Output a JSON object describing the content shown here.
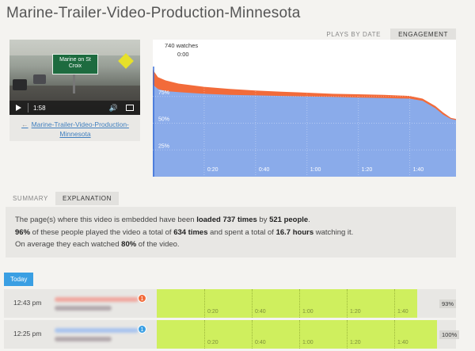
{
  "page_title": "Marine-Trailer-Video-Production-Minnesota",
  "top_tabs": [
    {
      "label": "PLAYS BY DATE",
      "active": false
    },
    {
      "label": "ENGAGEMENT",
      "active": true
    }
  ],
  "video": {
    "sign_text": "Marine on St Croix",
    "time": "1:58",
    "link": "Marine-Trailer-Video-Production-Minnesota"
  },
  "chart_data": {
    "type": "area",
    "x_unit": "seconds",
    "xlim": [
      0,
      118
    ],
    "ylim": [
      0,
      100
    ],
    "x_ticks": [
      20,
      40,
      60,
      80,
      100
    ],
    "x_tick_labels": [
      "0:20",
      "0:40",
      "1:00",
      "1:20",
      "1:40"
    ],
    "y_ticks": [
      25,
      50,
      75
    ],
    "y_tick_labels": [
      "25%",
      "50%",
      "75%"
    ],
    "hover": {
      "watches": "740 watches",
      "time": "0:00"
    },
    "series": [
      {
        "color": "#f26b3a",
        "x": [
          0,
          2,
          5,
          10,
          20,
          30,
          40,
          50,
          60,
          70,
          80,
          90,
          100,
          105,
          110,
          113,
          116,
          118
        ],
        "y": [
          100,
          93,
          90,
          87,
          84,
          82,
          80.5,
          79.5,
          78.5,
          77.5,
          77,
          76.5,
          75.5,
          73,
          66,
          60,
          55,
          54
        ]
      },
      {
        "color": "#8aabea",
        "x": [
          0,
          2,
          5,
          10,
          20,
          30,
          40,
          50,
          60,
          70,
          80,
          90,
          100,
          105,
          110,
          113,
          116,
          118
        ],
        "y": [
          86,
          82,
          80,
          79,
          77.5,
          76.5,
          76,
          75.5,
          75,
          74.5,
          74,
          73.5,
          73,
          71,
          64,
          58,
          54,
          53
        ]
      }
    ]
  },
  "sub_tabs": [
    {
      "label": "SUMMARY",
      "active": false
    },
    {
      "label": "EXPLANATION",
      "active": true
    }
  ],
  "explanation": {
    "l1_a": "The page(s) where this video is embedded have been ",
    "l1_b": "loaded 737 times",
    "l1_c": " by ",
    "l1_d": "521 people",
    "l1_e": ".",
    "l2_a": "96%",
    "l2_b": " of these people played the video a total of ",
    "l2_c": "634 times",
    "l2_d": " and spent a total of ",
    "l2_e": "16.7 hours",
    "l2_f": " watching it.",
    "l3_a": "On average they each watched ",
    "l3_b": "80%",
    "l3_c": " of the video."
  },
  "today_label": "Today",
  "sessions": [
    {
      "time": "12:43 pm",
      "badge": "1",
      "badge_color": "#f26b3a",
      "blur_color": "#f0a8a0",
      "percent": "93%",
      "watched_fraction": 0.93
    },
    {
      "time": "12:25 pm",
      "badge": "1",
      "badge_color": "#3a9fe3",
      "blur_color": "#a9c4ee",
      "percent": "100%",
      "watched_fraction": 1.0
    }
  ]
}
